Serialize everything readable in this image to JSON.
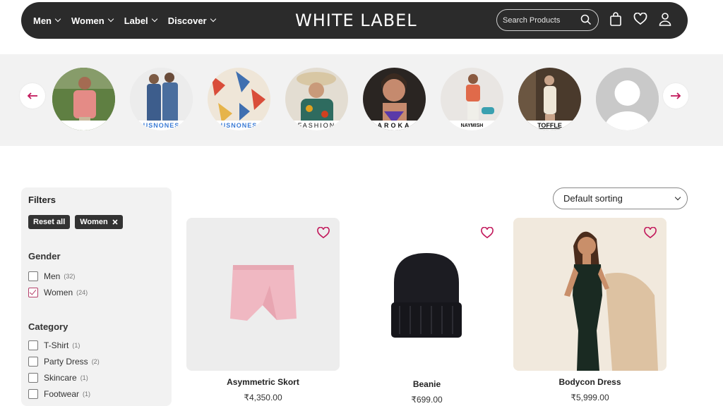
{
  "nav": {
    "menu": [
      {
        "label": "Men"
      },
      {
        "label": "Women"
      },
      {
        "label": "Label"
      },
      {
        "label": "Discover"
      }
    ],
    "logo": "WHITE LABEL",
    "search_placeholder": "Search Products"
  },
  "brands": [
    {
      "label": ""
    },
    {
      "label": "USNONES"
    },
    {
      "label": "USNONES"
    },
    {
      "label": "FASHION"
    },
    {
      "label": "AROKA"
    },
    {
      "label": "NAYMISH"
    },
    {
      "label": "TOFFLE"
    },
    {
      "label": ""
    }
  ],
  "filters": {
    "title": "Filters",
    "chips": [
      {
        "label": "Reset all"
      },
      {
        "label": "Women"
      }
    ],
    "gender": {
      "title": "Gender",
      "options": [
        {
          "label": "Men",
          "count": "(32)",
          "checked": false
        },
        {
          "label": "Women",
          "count": "(24)",
          "checked": true
        }
      ]
    },
    "category": {
      "title": "Category",
      "options": [
        {
          "label": "T-Shirt",
          "count": "(1)"
        },
        {
          "label": "Party Dress",
          "count": "(2)"
        },
        {
          "label": "Skincare",
          "count": "(1)"
        },
        {
          "label": "Footwear",
          "count": "(1)"
        }
      ]
    }
  },
  "sort": {
    "selected": "Default sorting"
  },
  "products": [
    {
      "name": "Asymmetric Skort",
      "price": "₹4,350.00"
    },
    {
      "name": "Beanie",
      "price": "₹699.00"
    },
    {
      "name": "Bodycon Dress",
      "price": "₹5,999.00"
    }
  ],
  "colors": {
    "nav_bg": "#2b2b2b",
    "accent": "#b5406a",
    "panel_bg": "#f2f2f2"
  },
  "icons": [
    "chevron-down-icon",
    "search-icon",
    "cart-icon",
    "heart-icon",
    "user-icon",
    "arrow-left-icon",
    "arrow-right-icon",
    "close-icon",
    "checkbox-icon"
  ]
}
